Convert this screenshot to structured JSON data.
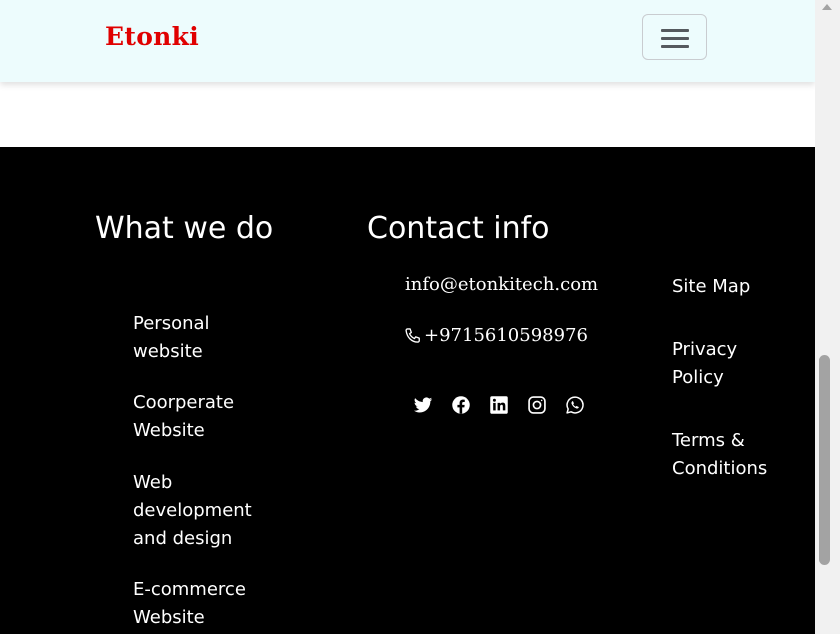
{
  "navbar": {
    "brand": "Etonki",
    "brand_color": "#e00000",
    "background": "#edfcfd",
    "toggler_icon": "hamburger-menu-icon"
  },
  "footer": {
    "background": "#000000",
    "what_we_do": {
      "title": "What we do",
      "items": [
        {
          "label": "Personal website"
        },
        {
          "label": "Coorperate Website"
        },
        {
          "label": "Web development and design"
        },
        {
          "label": "E-commerce Website"
        }
      ]
    },
    "contact": {
      "title": "Contact info",
      "email": "info@etonkitech.com",
      "phone": "+9715610598976",
      "socials": [
        {
          "icon": "twitter-icon"
        },
        {
          "icon": "facebook-icon"
        },
        {
          "icon": "linkedin-icon"
        },
        {
          "icon": "instagram-icon"
        },
        {
          "icon": "whatsapp-icon"
        }
      ]
    },
    "links": [
      {
        "label": "Site Map"
      },
      {
        "label": "Privacy Policy"
      },
      {
        "label": "Terms & Conditions"
      }
    ]
  }
}
